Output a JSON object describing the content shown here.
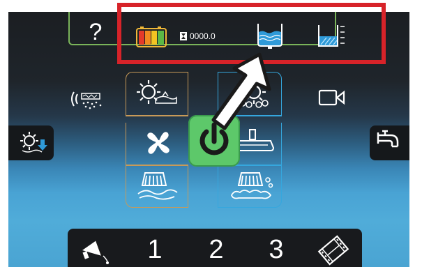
{
  "top": {
    "help_label": "?",
    "counter_value": "0000.0"
  },
  "bottom_nav": {
    "items": [
      {
        "label": "1"
      },
      {
        "label": "2"
      },
      {
        "label": "3"
      }
    ]
  },
  "colors": {
    "highlight": "#d72329",
    "power_button": "#5dc86a",
    "left_group_outline": "#c89a58",
    "right_group_outline": "#35a7de",
    "top_card_outline": "#7ab45a"
  },
  "icons": {
    "battery": "battery-icon",
    "hourglass": "hourglass-icon",
    "clean_water": "clean-water-tank-icon",
    "dirty_water": "dirty-water-tank-icon",
    "noise": "noise-level-icon",
    "camera": "camera-icon",
    "brush_left": "side-brush-icon",
    "faucet": "faucet-icon",
    "power": "power-icon",
    "vacuum": "vacuum-fan-icon",
    "squeegee": "squeegee-icon",
    "scrub_brush": "scrub-brush-icon",
    "detergent_brush": "detergent-brush-icon",
    "foam_brush": "foam-brush-icon",
    "foam_scrub": "foam-scrub-icon",
    "pointer_arrow": "pointer-arrow-icon",
    "announcement": "announcement-icon",
    "film": "film-icon"
  }
}
